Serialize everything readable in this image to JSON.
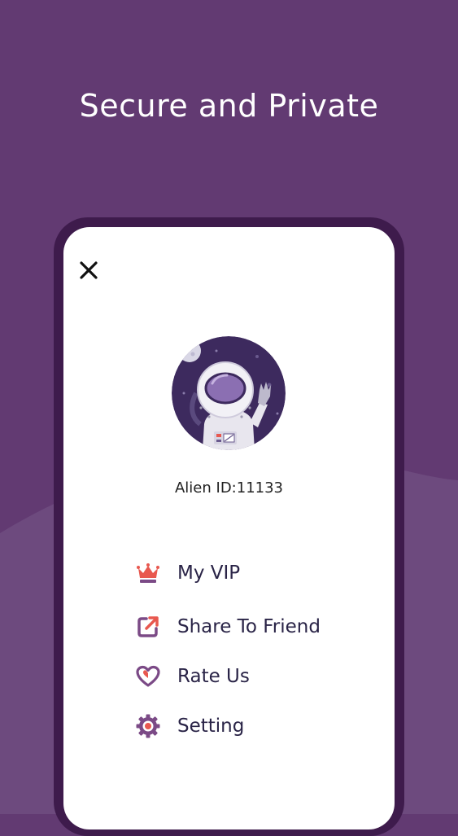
{
  "headline": "Secure and Private",
  "profile": {
    "user_id": "Alien ID:11133"
  },
  "menu": {
    "items": [
      {
        "label": "My VIP",
        "icon": "crown-icon"
      },
      {
        "label": "Share To Friend",
        "icon": "share-icon"
      },
      {
        "label": "Rate Us",
        "icon": "heart-icon"
      },
      {
        "label": "Setting",
        "icon": "gear-icon"
      }
    ]
  },
  "colors": {
    "background": "#623a72",
    "wave": "#6d4a7e",
    "phone_frame": "#3e1b4c",
    "screen": "#ffffff",
    "vip_accent": "#e8584f",
    "icon_purple": "#7b4a86",
    "label_text": "#2a2447"
  }
}
